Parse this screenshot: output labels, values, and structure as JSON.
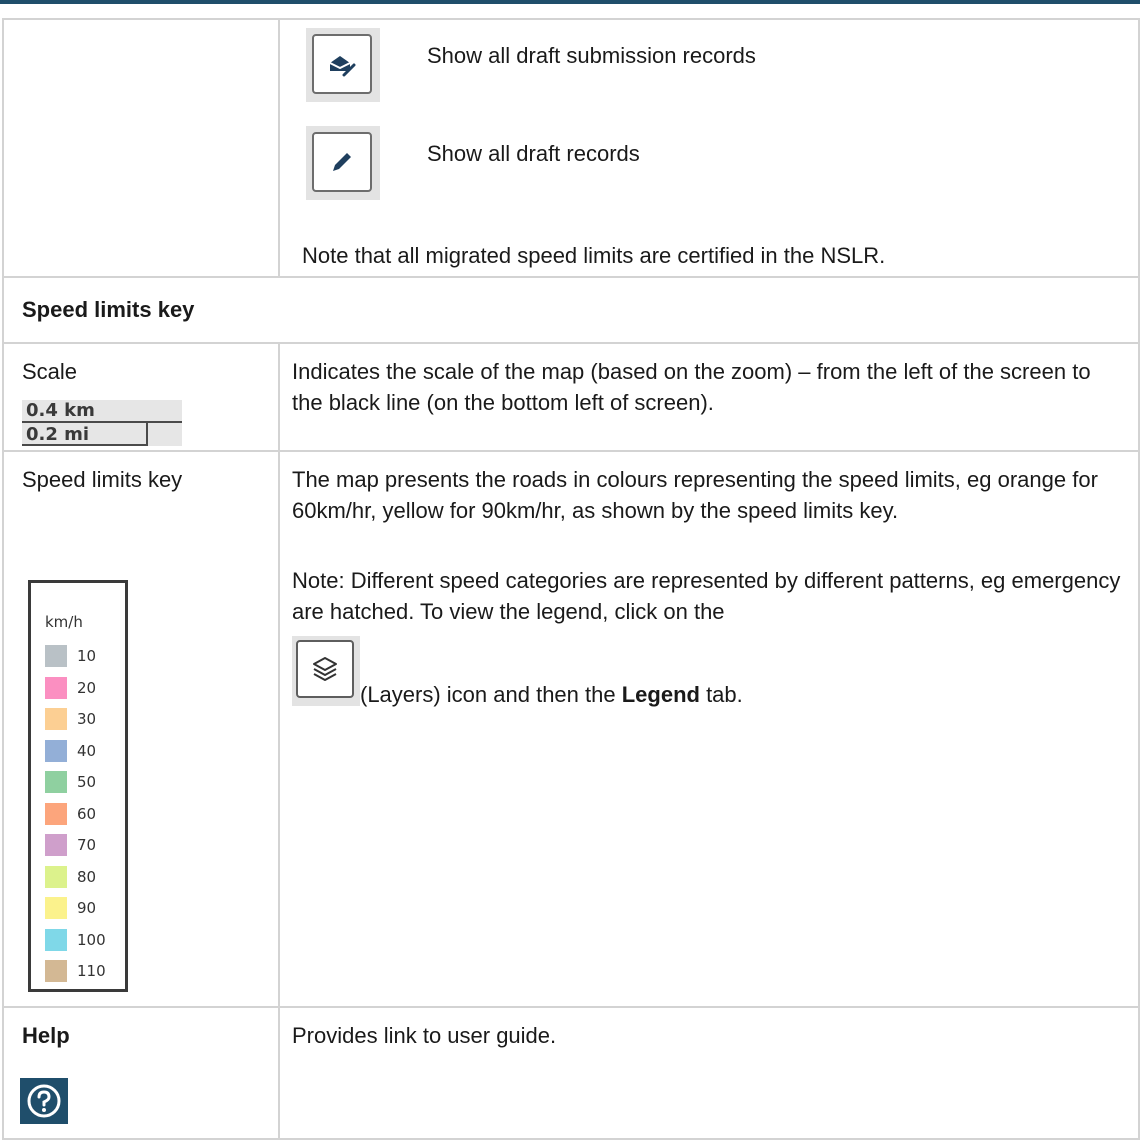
{
  "drafts": {
    "submission_text": "Show all draft submission records",
    "drafts_text": "Show all draft records",
    "note": "Note that all migrated speed limits are certified in the NSLR."
  },
  "section": {
    "heading": "Speed limits key"
  },
  "scale": {
    "label": "Scale",
    "km": "0.4 km",
    "mi": "0.2 mi",
    "description": "Indicates the scale of the map (based on the zoom) – from the left of the screen to the black line (on the bottom left of screen)."
  },
  "speedkey": {
    "label": "Speed limits key",
    "description": "The map presents the roads in colours representing the speed limits, eg orange for 60km/hr, yellow for 90km/hr, as shown by the speed limits key.",
    "note": "Note: Different speed categories are represented by different patterns, eg emergency are hatched. To view the legend, click on the",
    "note_tail_1": " (Layers) icon and then the ",
    "note_bold": "Legend",
    "note_tail_2": " tab.",
    "legend": {
      "unit": "km/h",
      "items": [
        {
          "label": "10",
          "color": "#b9c1c6"
        },
        {
          "label": "20",
          "color": "#fb8fc1"
        },
        {
          "label": "30",
          "color": "#fccf93"
        },
        {
          "label": "40",
          "color": "#93afd7"
        },
        {
          "label": "50",
          "color": "#8fd0a0"
        },
        {
          "label": "60",
          "color": "#fca57c"
        },
        {
          "label": "70",
          "color": "#cf9fcb"
        },
        {
          "label": "80",
          "color": "#dcf28c"
        },
        {
          "label": "90",
          "color": "#fbf28c"
        },
        {
          "label": "100",
          "color": "#7fd8e8"
        },
        {
          "label": "110",
          "color": "#d3b894"
        }
      ]
    }
  },
  "help": {
    "label": "Help",
    "description": "Provides link to user guide.",
    "icon_color": "#1f4e6b"
  }
}
